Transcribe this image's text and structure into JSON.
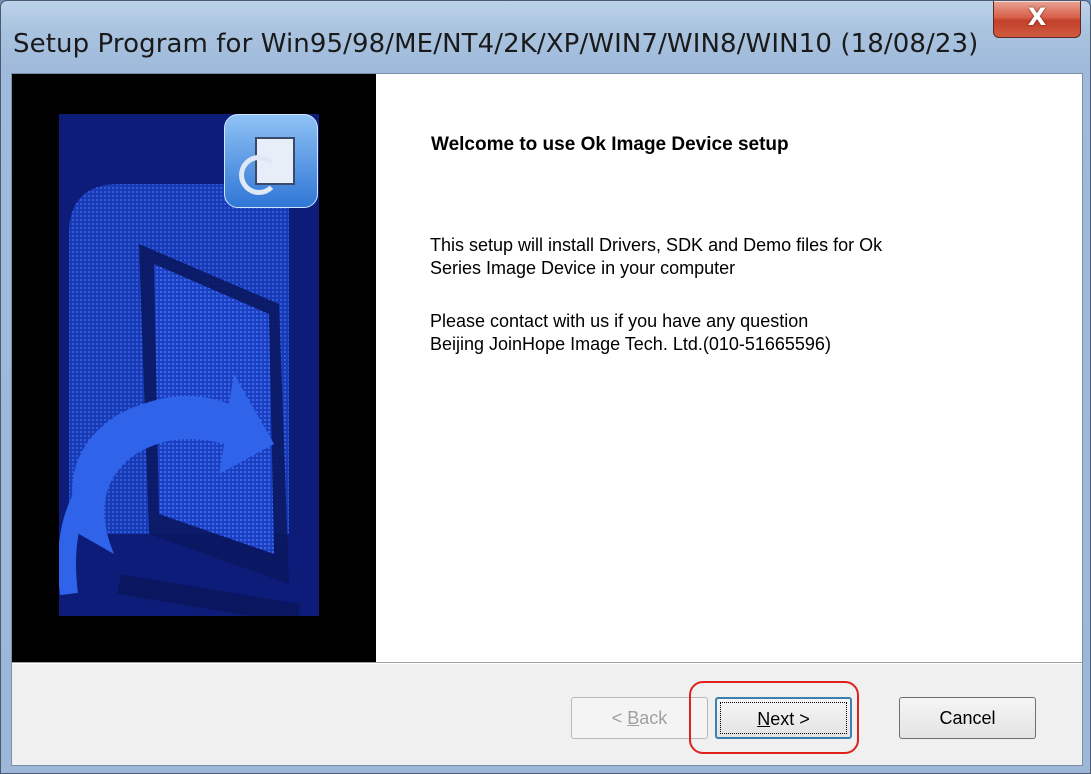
{
  "window": {
    "title": "Setup Program for Win95/98/ME/NT4/2K/XP/WIN7/WIN8/WIN10  (18/08/23)",
    "close_glyph": "X"
  },
  "content": {
    "heading": "Welcome to use Ok Image Device setup",
    "para1_line1": "This setup will install Drivers, SDK and Demo files for Ok",
    "para1_line2": "Series Image Device in your computer",
    "para2_line1": "Please contact with us if you have any question",
    "para2_line2": "Beijing JoinHope Image Tech. Ltd.(010-51665596)"
  },
  "buttons": {
    "back_prefix": "< ",
    "back_mnemonic": "B",
    "back_rest": "ack",
    "next_mnemonic": "N",
    "next_rest": "ext >",
    "cancel": "Cancel"
  },
  "colors": {
    "accent_highlight": "#e0211d",
    "banner_blue": "#1a45c8"
  },
  "icons": {
    "banner_logo": "computer-install-icon"
  }
}
